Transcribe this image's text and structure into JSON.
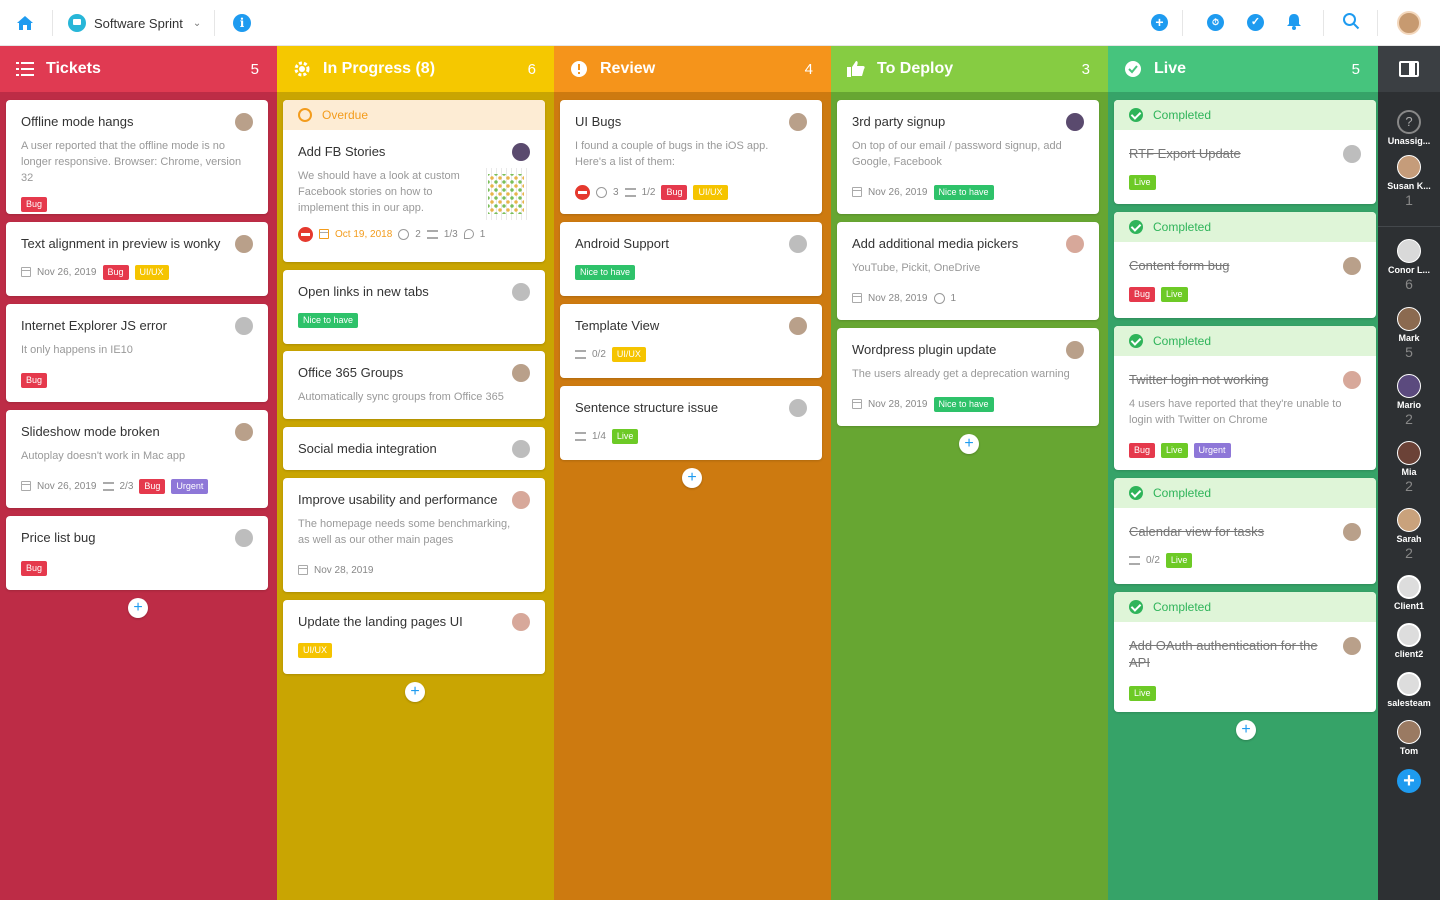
{
  "topbar": {
    "project_name": "Software Sprint"
  },
  "colors": {
    "tickets": "#cc2c47",
    "inprogress": "#d4ac00",
    "review": "#e8860b",
    "todeploy": "#6cb52a",
    "live": "#3aad6c",
    "accent": "#1e9bf0"
  },
  "columns": {
    "tickets": {
      "title": "Tickets",
      "count": "5"
    },
    "inprogress": {
      "title": "In Progress (8)",
      "count": "6"
    },
    "review": {
      "title": "Review",
      "count": "4"
    },
    "todeploy": {
      "title": "To Deploy",
      "count": "3"
    },
    "live": {
      "title": "Live",
      "count": "5"
    }
  },
  "tickets": [
    {
      "title": "Offline mode hangs",
      "desc": "A user reported that the offline mode is no longer responsive. Browser: Chrome, version 32",
      "tag1": "Bug"
    },
    {
      "title": "Text alignment in preview is wonky",
      "date": "Nov 26, 2019",
      "tag1": "Bug",
      "tag2": "UI/UX"
    },
    {
      "title": "Internet Explorer JS error",
      "desc": "It only happens in IE10",
      "tag1": "Bug"
    },
    {
      "title": "Slideshow mode broken",
      "desc": "Autoplay doesn't work in Mac app",
      "date": "Nov 26, 2019",
      "checks": "2/3",
      "tag1": "Bug",
      "tag2": "Urgent"
    },
    {
      "title": "Price list bug",
      "tag1": "Bug"
    }
  ],
  "inprogress": [
    {
      "banner": "Overdue",
      "title": "Add FB Stories",
      "desc": "We should have a look at custom Facebook stories on how to implement this in our app.",
      "date": "Oct 19, 2018",
      "comments": "2",
      "checks": "1/3",
      "attachments": "1"
    },
    {
      "title": "Open links in new tabs",
      "tag1": "Nice to have"
    },
    {
      "title": "Office 365 Groups",
      "desc": "Automatically sync groups from Office 365"
    },
    {
      "title": "Social media integration"
    },
    {
      "title": "Improve usability and performance",
      "desc": "The homepage needs some benchmarking, as well as our other main pages",
      "date": "Nov 28, 2019"
    },
    {
      "title": "Update the landing pages UI",
      "tag1": "UI/UX"
    }
  ],
  "review": [
    {
      "title": "UI Bugs",
      "desc": "I found a couple of bugs in the iOS app. Here's a list of them:",
      "comments": "3",
      "checks": "1/2",
      "tag1": "Bug",
      "tag2": "UI/UX"
    },
    {
      "title": "Android Support",
      "tag1": "Nice to have"
    },
    {
      "title": "Template View",
      "checks": "0/2",
      "tag1": "UI/UX"
    },
    {
      "title": "Sentence structure issue",
      "checks": "1/4",
      "tag1": "Live"
    }
  ],
  "todeploy": [
    {
      "title": "3rd party signup",
      "desc": "On top of our email / password signup, add Google, Facebook",
      "date": "Nov 26, 2019",
      "tag1": "Nice to have"
    },
    {
      "title": "Add additional media pickers",
      "desc": "YouTube, Pickit, OneDrive",
      "date": "Nov 28, 2019",
      "comments": "1"
    },
    {
      "title": "Wordpress plugin update",
      "desc": "The users already get a deprecation warning",
      "date": "Nov 28, 2019",
      "tag1": "Nice to have"
    }
  ],
  "live": [
    {
      "banner": "Completed",
      "title": "RTF Export Update",
      "tag1": "Live"
    },
    {
      "banner": "Completed",
      "title": "Content form bug",
      "tag1": "Bug",
      "tag2": "Live"
    },
    {
      "banner": "Completed",
      "title": "Twitter login not working",
      "desc": "4 users have reported that they're unable to login with Twitter on Chrome",
      "tag1": "Bug",
      "tag2": "Live",
      "tag3": "Urgent"
    },
    {
      "banner": "Completed",
      "title": "Calendar view for tasks",
      "checks": "0/2",
      "tag1": "Live"
    },
    {
      "banner": "Completed",
      "title": "Add OAuth authentication for the API",
      "tag1": "Live"
    }
  ],
  "sidebar": [
    {
      "name": "Unassig...",
      "count": ""
    },
    {
      "name": "Susan K...",
      "count": "1"
    },
    {
      "name": "Conor L...",
      "count": "6"
    },
    {
      "name": "Mark",
      "count": "5"
    },
    {
      "name": "Mario",
      "count": "2"
    },
    {
      "name": "Mia",
      "count": "2"
    },
    {
      "name": "Sarah",
      "count": "2"
    },
    {
      "name": "Client1",
      "count": ""
    },
    {
      "name": "client2",
      "count": ""
    },
    {
      "name": "salesteam",
      "count": ""
    },
    {
      "name": "Tom",
      "count": ""
    }
  ],
  "icons": {
    "home": "home-icon",
    "info": "info-icon",
    "add": "plus-circle-icon",
    "timer": "timer-icon",
    "check": "check-circle-icon",
    "bell": "bell-icon",
    "search": "search-icon"
  }
}
